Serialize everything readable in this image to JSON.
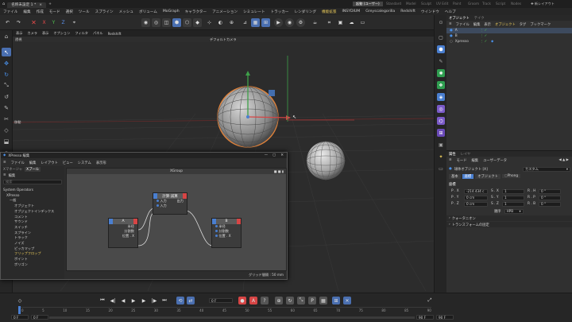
{
  "titlebar": {
    "doc_tab": "名称未設定 1 *",
    "layouts": [
      "起動",
      "ユーザー",
      "Standard",
      "Model",
      "Sculpt",
      "UV Edit",
      "Paint",
      "Groom",
      "Track",
      "Script",
      "Nodes"
    ],
    "new_layout": "新レイアウト"
  },
  "menu": [
    "ファイル",
    "編集",
    "作成",
    "モード",
    "選択",
    "ツール",
    "スプライン",
    "メッシュ",
    "ボリューム",
    "MoGraph",
    "キャラクター",
    "アニメーション",
    "シミュレート",
    "トラッカー",
    "レンダリング",
    "機能拡張",
    "INSYDIUM",
    "Greyscalegorilla",
    "Redshift",
    "ウインドウ",
    "ヘルプ"
  ],
  "toolbar": {
    "axes": [
      "X",
      "Y",
      "Z"
    ]
  },
  "viewport": {
    "menu": [
      "表示",
      "カメラ",
      "表示",
      "オプション",
      "フィルタ",
      "パネル",
      "Redshift"
    ],
    "view_name": "透視",
    "camera": "デフォルトカメラ",
    "status": "移動"
  },
  "objects": {
    "tabs": [
      "オブジェクト",
      "テイク"
    ],
    "menu": [
      "ファイル",
      "編集",
      "表示",
      "オブジェクト",
      "タグ",
      "ブックマーク"
    ],
    "items": [
      {
        "name": "A"
      },
      {
        "name": "B"
      },
      {
        "name": "Xpresso"
      }
    ]
  },
  "attributes": {
    "tabs": [
      "属性",
      "レイヤ"
    ],
    "menu": [
      "モード",
      "編集",
      "ユーザーデータ"
    ],
    "object": "球体オブジェクト [A]",
    "mode": "カスタム",
    "subtabs": [
      "基本",
      "座標",
      "オブジェクト",
      "Phong"
    ],
    "section": "座標",
    "rows": [
      {
        "a": "P . X",
        "av": "-214.434 c",
        "b": "S . X",
        "bv": "1",
        "c": "R . H",
        "cv": "0 °"
      },
      {
        "a": "P . Y",
        "av": "0 cm",
        "b": "S . Y",
        "bv": "1",
        "c": "R . P",
        "cv": "0 °"
      },
      {
        "a": "P . Z",
        "av": "0 cm",
        "b": "S . Z",
        "bv": "1",
        "c": "R . B",
        "cv": "0 °"
      }
    ],
    "order_label": "順序",
    "order_value": "HPB",
    "sections": [
      "クォータニオン",
      "トランスフォームの固定"
    ]
  },
  "xpresso": {
    "title": "XPresso 編集",
    "menu": [
      "ファイル",
      "編集",
      "レイアウト",
      "ビュー",
      "カリキュラム",
      "表示设定"
    ],
    "menu_real": [
      "ファイル",
      "編集",
      "レイアウト",
      "ビュー",
      "システム",
      "表示形"
    ],
    "tabs": [
      "Xマネージャ",
      "Xプール"
    ],
    "subtab": "編集",
    "search": "検索",
    "group": "XGroup",
    "tree": [
      "System Operators",
      "XPresso",
      "一般",
      "オブジェクト",
      "オブジェクトインデックス",
      "コメント",
      "サウンド",
      "スイッチ",
      "スプライン",
      "トラック",
      "ノイズ",
      "ピッカマップ",
      "フリップフロップ",
      "ポイント",
      "ポリゴン"
    ],
    "status": "グリッド間隔 : 50 mm",
    "node_calc": {
      "title": "計算:減算",
      "in1": "入力",
      "in2": "入力",
      "out": "出力"
    },
    "node_a": {
      "title": "A",
      "p1": "半径",
      "p2": "分割数",
      "p3": "位置 . X"
    },
    "node_b": {
      "title": "B",
      "p1": "半径",
      "p2": "分割数",
      "p3": "位置 . X"
    }
  },
  "timeline": {
    "frame": "0 F",
    "start": "0 F",
    "end": "90 F",
    "start2": "0 F",
    "end2": "90 F",
    "ticks": [
      "0",
      "5",
      "10",
      "15",
      "20",
      "25",
      "30",
      "35",
      "40",
      "45",
      "50",
      "55",
      "60",
      "65",
      "70",
      "75",
      "80",
      "85",
      "90"
    ]
  },
  "colors": {
    "accent": "#4a7fd0",
    "yellow": "#e8c95a",
    "red": "#d64545",
    "green": "#3ea049",
    "orange": "#e0823a"
  }
}
